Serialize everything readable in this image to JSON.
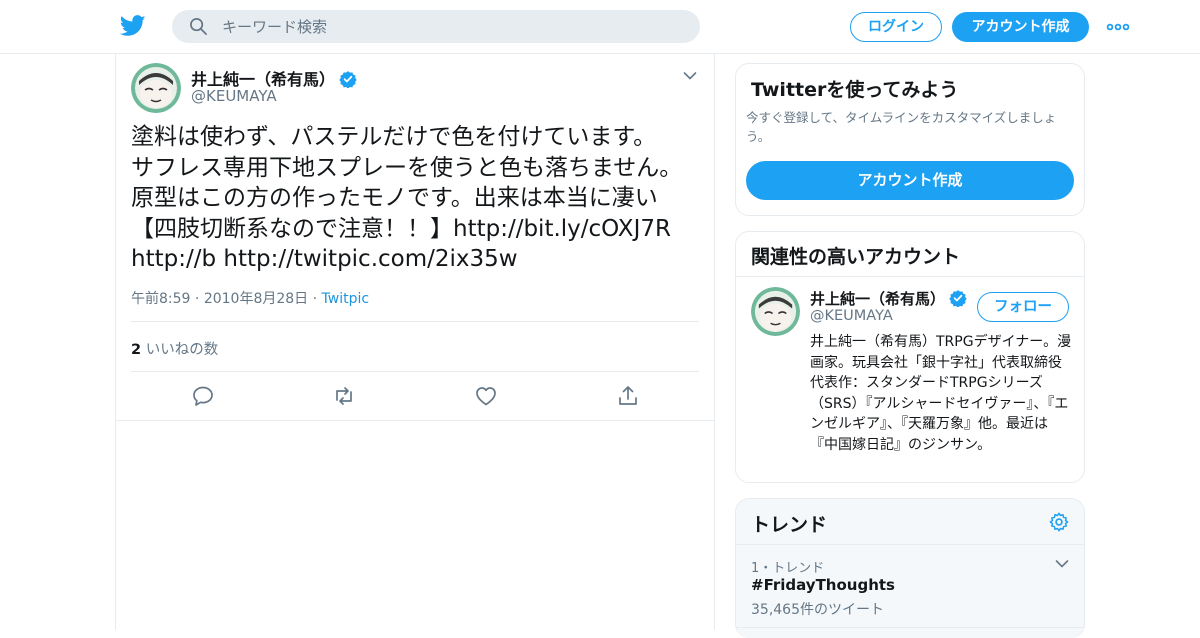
{
  "header": {
    "search_placeholder": "キーワード検索",
    "login_label": "ログイン",
    "signup_label": "アカウント作成",
    "brand_color": "#1da1f2"
  },
  "tweet": {
    "author_name": "井上純一（希有馬）",
    "author_handle": "@KEUMAYA",
    "text": "塗料は使わず、パステルだけで色を付けています。\nサフレス専用下地スプレーを使うと色も落ちません。\n原型はこの方の作ったモノです。出来は本当に凄い\n【四肢切断系なので注意！！】http://bit.ly/cOXJ7R\nhttp://b http://twitpic.com/2ix35w",
    "time": "午前8:59",
    "date": "2010年8月28日",
    "separator": "·",
    "source": "Twitpic",
    "likes_count": "2",
    "likes_label": "いいねの数"
  },
  "sidebar": {
    "signup": {
      "title": "Twitterを使ってみよう",
      "description": "今すぐ登録して、タイムラインをカスタマイズしましょう。",
      "button_label": "アカウント作成"
    },
    "related": {
      "title": "関連性の高いアカウント",
      "name": "井上純一（希有馬）",
      "handle": "@KEUMAYA",
      "follow_label": "フォロー",
      "bio": "井上純一（希有馬）TRPGデザイナー。漫画家。玩具会社「銀十字社」代表取締役 代表作：スタンダードTRPGシリーズ（SRS）『アルシャードセイヴァー』、『エンゼルギア』、『天羅万象』他。最近は『中国嫁日記』のジンサン。"
    },
    "trends": {
      "title": "トレンド",
      "items": [
        {
          "rank": "1・トレンド",
          "name": "#FridayThoughts",
          "count": "35,465件のツイート"
        }
      ]
    }
  },
  "icons": [
    "twitter-bird-icon",
    "search-icon",
    "more-dots-icon",
    "verified-badge-icon",
    "chevron-down-icon",
    "reply-icon",
    "retweet-icon",
    "like-icon",
    "share-icon",
    "gear-icon"
  ]
}
